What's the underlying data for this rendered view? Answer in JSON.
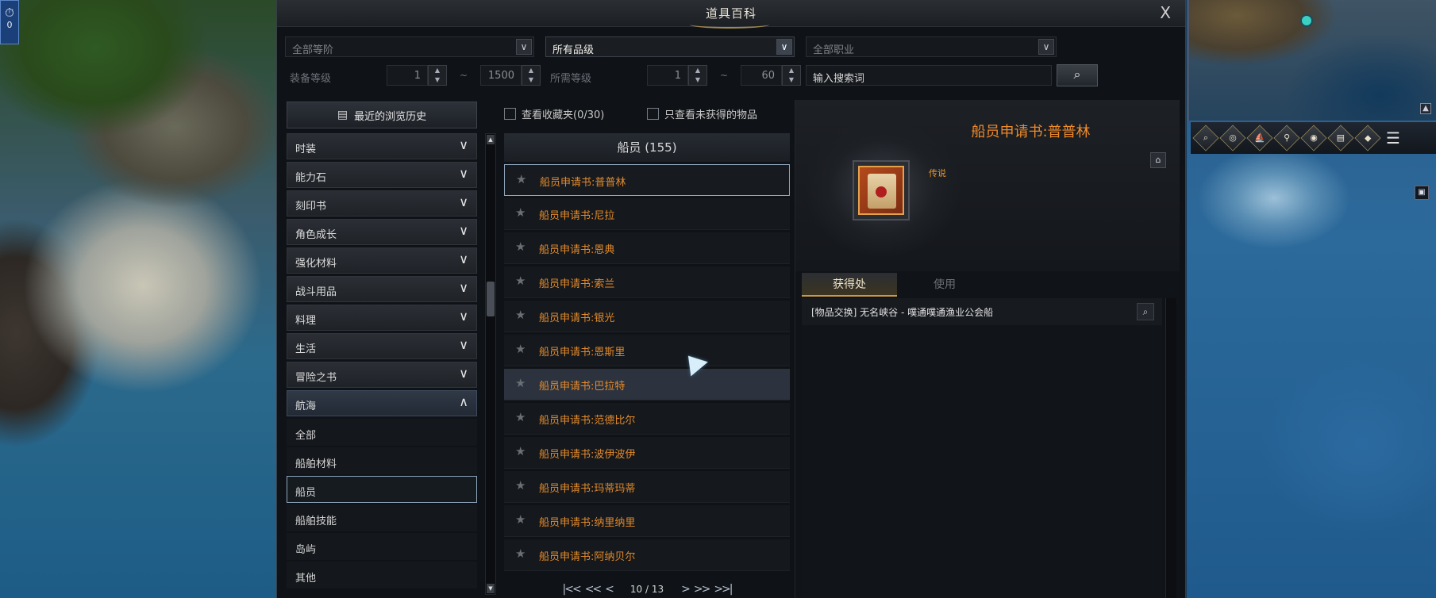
{
  "window": {
    "title": "道具百科",
    "close_label": "X"
  },
  "filters": {
    "tier_dropdown": "全部等阶",
    "grade_dropdown": "所有品级",
    "class_dropdown": "全部职业",
    "item_level_label": "装备等级",
    "item_level_min": "1",
    "item_level_max": "1500",
    "required_level_label": "所需等级",
    "required_level_min": "1",
    "required_level_max": "60",
    "range_separator": "~",
    "search_placeholder": "输入搜索词"
  },
  "history_button": "最近的浏览历史",
  "checkboxes": {
    "favorites": "查看收藏夹(0/30)",
    "unobtained": "只查看未获得的物品"
  },
  "categories": [
    {
      "label": "时装",
      "open": false
    },
    {
      "label": "能力石",
      "open": false
    },
    {
      "label": "刻印书",
      "open": false
    },
    {
      "label": "角色成长",
      "open": false
    },
    {
      "label": "强化材料",
      "open": false
    },
    {
      "label": "战斗用品",
      "open": false
    },
    {
      "label": "料理",
      "open": false
    },
    {
      "label": "生活",
      "open": false
    },
    {
      "label": "冒险之书",
      "open": false
    },
    {
      "label": "航海",
      "open": true
    }
  ],
  "subcategories": [
    {
      "label": "全部",
      "selected": false
    },
    {
      "label": "船舶材料",
      "selected": false
    },
    {
      "label": "船员",
      "selected": true
    },
    {
      "label": "船舶技能",
      "selected": false
    },
    {
      "label": "岛屿",
      "selected": false
    },
    {
      "label": "其他",
      "selected": false
    }
  ],
  "item_list": {
    "header": "船员 (155)",
    "items": [
      {
        "name": "船员申请书:普普林",
        "state": "selected"
      },
      {
        "name": "船员申请书:尼拉",
        "state": ""
      },
      {
        "name": "船员申请书:恩典",
        "state": ""
      },
      {
        "name": "船员申请书:索兰",
        "state": ""
      },
      {
        "name": "船员申请书:银光",
        "state": ""
      },
      {
        "name": "船员申请书:恩斯里",
        "state": ""
      },
      {
        "name": "船员申请书:巴拉特",
        "state": "hover"
      },
      {
        "name": "船员申请书:范德比尔",
        "state": ""
      },
      {
        "name": "船员申请书:波伊波伊",
        "state": ""
      },
      {
        "name": "船员申请书:玛蒂玛蒂",
        "state": ""
      },
      {
        "name": "船员申请书:纳里纳里",
        "state": ""
      },
      {
        "name": "船员申请书:阿纳贝尔",
        "state": ""
      }
    ],
    "pager": {
      "first": "|<<",
      "prev_page": "<<",
      "prev": "<",
      "current": "10 / 13",
      "next": ">",
      "next_page": ">>",
      "last": ">>|"
    }
  },
  "detail": {
    "title": "船员申请书:普普林",
    "grade": "传说",
    "tabs": [
      "获得处",
      "使用"
    ],
    "active_tab": "获得处",
    "sources": [
      "[物品交换] 无名峡谷 - 噗通噗通渔业公会船"
    ]
  },
  "hud": {
    "timer_value": "0",
    "minimap_buttons": [
      "map-search-icon",
      "compass-icon",
      "ship-icon",
      "party-search-icon",
      "camera-icon",
      "drum-icon",
      "diamond-icon",
      "menu-icon"
    ]
  },
  "colors": {
    "legendary_orange": "#e28a2c",
    "selection_border": "#8fa6bd",
    "gold_accent": "#c89a44"
  }
}
